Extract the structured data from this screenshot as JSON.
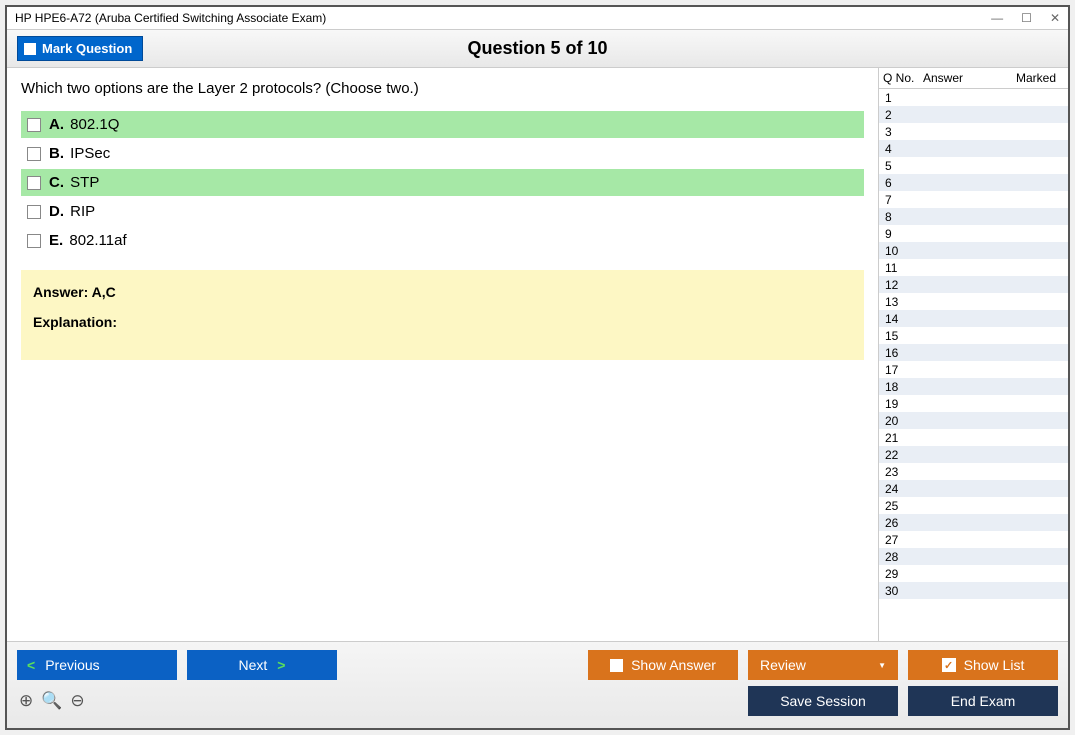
{
  "titlebar": {
    "title": "HP HPE6-A72 (Aruba Certified Switching Associate Exam)"
  },
  "toolbar": {
    "mark_label": "Mark Question",
    "question_heading": "Question 5 of 10"
  },
  "question": {
    "text": "Which two options are the Layer 2 protocols? (Choose two.)",
    "options": [
      {
        "letter": "A.",
        "text": "802.1Q",
        "correct": true
      },
      {
        "letter": "B.",
        "text": "IPSec",
        "correct": false
      },
      {
        "letter": "C.",
        "text": "STP",
        "correct": true
      },
      {
        "letter": "D.",
        "text": "RIP",
        "correct": false
      },
      {
        "letter": "E.",
        "text": "802.11af",
        "correct": false
      }
    ],
    "answer_label": "Answer: A,C",
    "explanation_label": "Explanation:"
  },
  "sidebar": {
    "col_qno": "Q No.",
    "col_answer": "Answer",
    "col_marked": "Marked",
    "rows": [
      {
        "n": "1"
      },
      {
        "n": "2"
      },
      {
        "n": "3"
      },
      {
        "n": "4"
      },
      {
        "n": "5"
      },
      {
        "n": "6"
      },
      {
        "n": "7"
      },
      {
        "n": "8"
      },
      {
        "n": "9"
      },
      {
        "n": "10"
      },
      {
        "n": "11"
      },
      {
        "n": "12"
      },
      {
        "n": "13"
      },
      {
        "n": "14"
      },
      {
        "n": "15"
      },
      {
        "n": "16"
      },
      {
        "n": "17"
      },
      {
        "n": "18"
      },
      {
        "n": "19"
      },
      {
        "n": "20"
      },
      {
        "n": "21"
      },
      {
        "n": "22"
      },
      {
        "n": "23"
      },
      {
        "n": "24"
      },
      {
        "n": "25"
      },
      {
        "n": "26"
      },
      {
        "n": "27"
      },
      {
        "n": "28"
      },
      {
        "n": "29"
      },
      {
        "n": "30"
      }
    ]
  },
  "footer": {
    "previous": "Previous",
    "next": "Next",
    "show_answer": "Show Answer",
    "review": "Review",
    "show_list": "Show List",
    "save_session": "Save Session",
    "end_exam": "End Exam"
  }
}
